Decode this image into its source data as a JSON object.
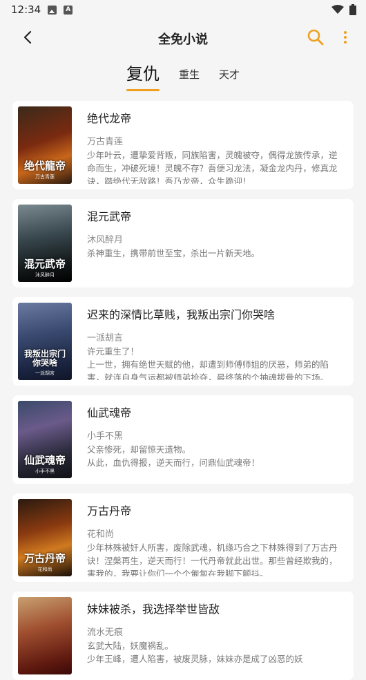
{
  "status_bar": {
    "time": "12:34"
  },
  "app_bar": {
    "title": "全免小说"
  },
  "tabs": [
    {
      "label": "复仇",
      "active": true
    },
    {
      "label": "重生",
      "active": false
    },
    {
      "label": "天才",
      "active": false
    }
  ],
  "colors": {
    "accent": "#f0a020"
  },
  "books": [
    {
      "title": "绝代龙帝",
      "author": "万古青莲",
      "desc": "少年叶云，遭挚爱背叛，同族陷害，灵魄被夺，偶得龙族传承，逆命而生，冲破死境！灵魄不存？吾便习龙法，凝金龙内丹，修真龙诀，踏绝代无敌路！吾乃龙帝，众生跪迎！",
      "cover_text": "绝代龍帝",
      "cover_author": "万古青莲"
    },
    {
      "title": "混元武帝",
      "author": "沐风醉月",
      "desc": "杀神重生，携带前世至宝，杀出一片新天地。",
      "cover_text": "混元武帝",
      "cover_author": "沐风醉月"
    },
    {
      "title": "迟来的深情比草贱，我叛出宗门你哭啥",
      "author": "一派胡言",
      "desc": "许元重生了！\n        上一世，拥有绝世天赋的他，却遭到师傅师姐的厌恶，师弟的陷害，就连自身气运都被师弟抢夺，最终落的个抽魂拔骨的下场。",
      "cover_text": "我叛出宗门你哭啥",
      "cover_author": "一派胡言"
    },
    {
      "title": "仙武魂帝",
      "author": "小手不黑",
      "desc": "父亲惨死，却留惊天遗物。\n        从此，血仇得报，逆天而行，问鼎仙武魂帝！",
      "cover_text": "仙武魂帝",
      "cover_author": "小手不黑"
    },
    {
      "title": "万古丹帝",
      "author": "花和尚",
      "desc": "少年林殊被奸人所害，废除武魂，机缘巧合之下林殊得到了万古丹诀！涅槃再生，逆天而行！一代丹帝就此出世。那些曾经欺我的，害我的，我要让你们一个个匍匐在我脚下颤抖。",
      "cover_text": "万古丹帝",
      "cover_author": "花和尚"
    },
    {
      "title": "妹妹被杀，我选择举世皆敌",
      "author": "流水无痕",
      "desc": "玄武大陆，妖魔祸乱。\n        少年王峰，遭人陷害，被废灵脉，妹妹亦是成了凶恶的妖",
      "cover_text": "",
      "cover_author": ""
    }
  ]
}
